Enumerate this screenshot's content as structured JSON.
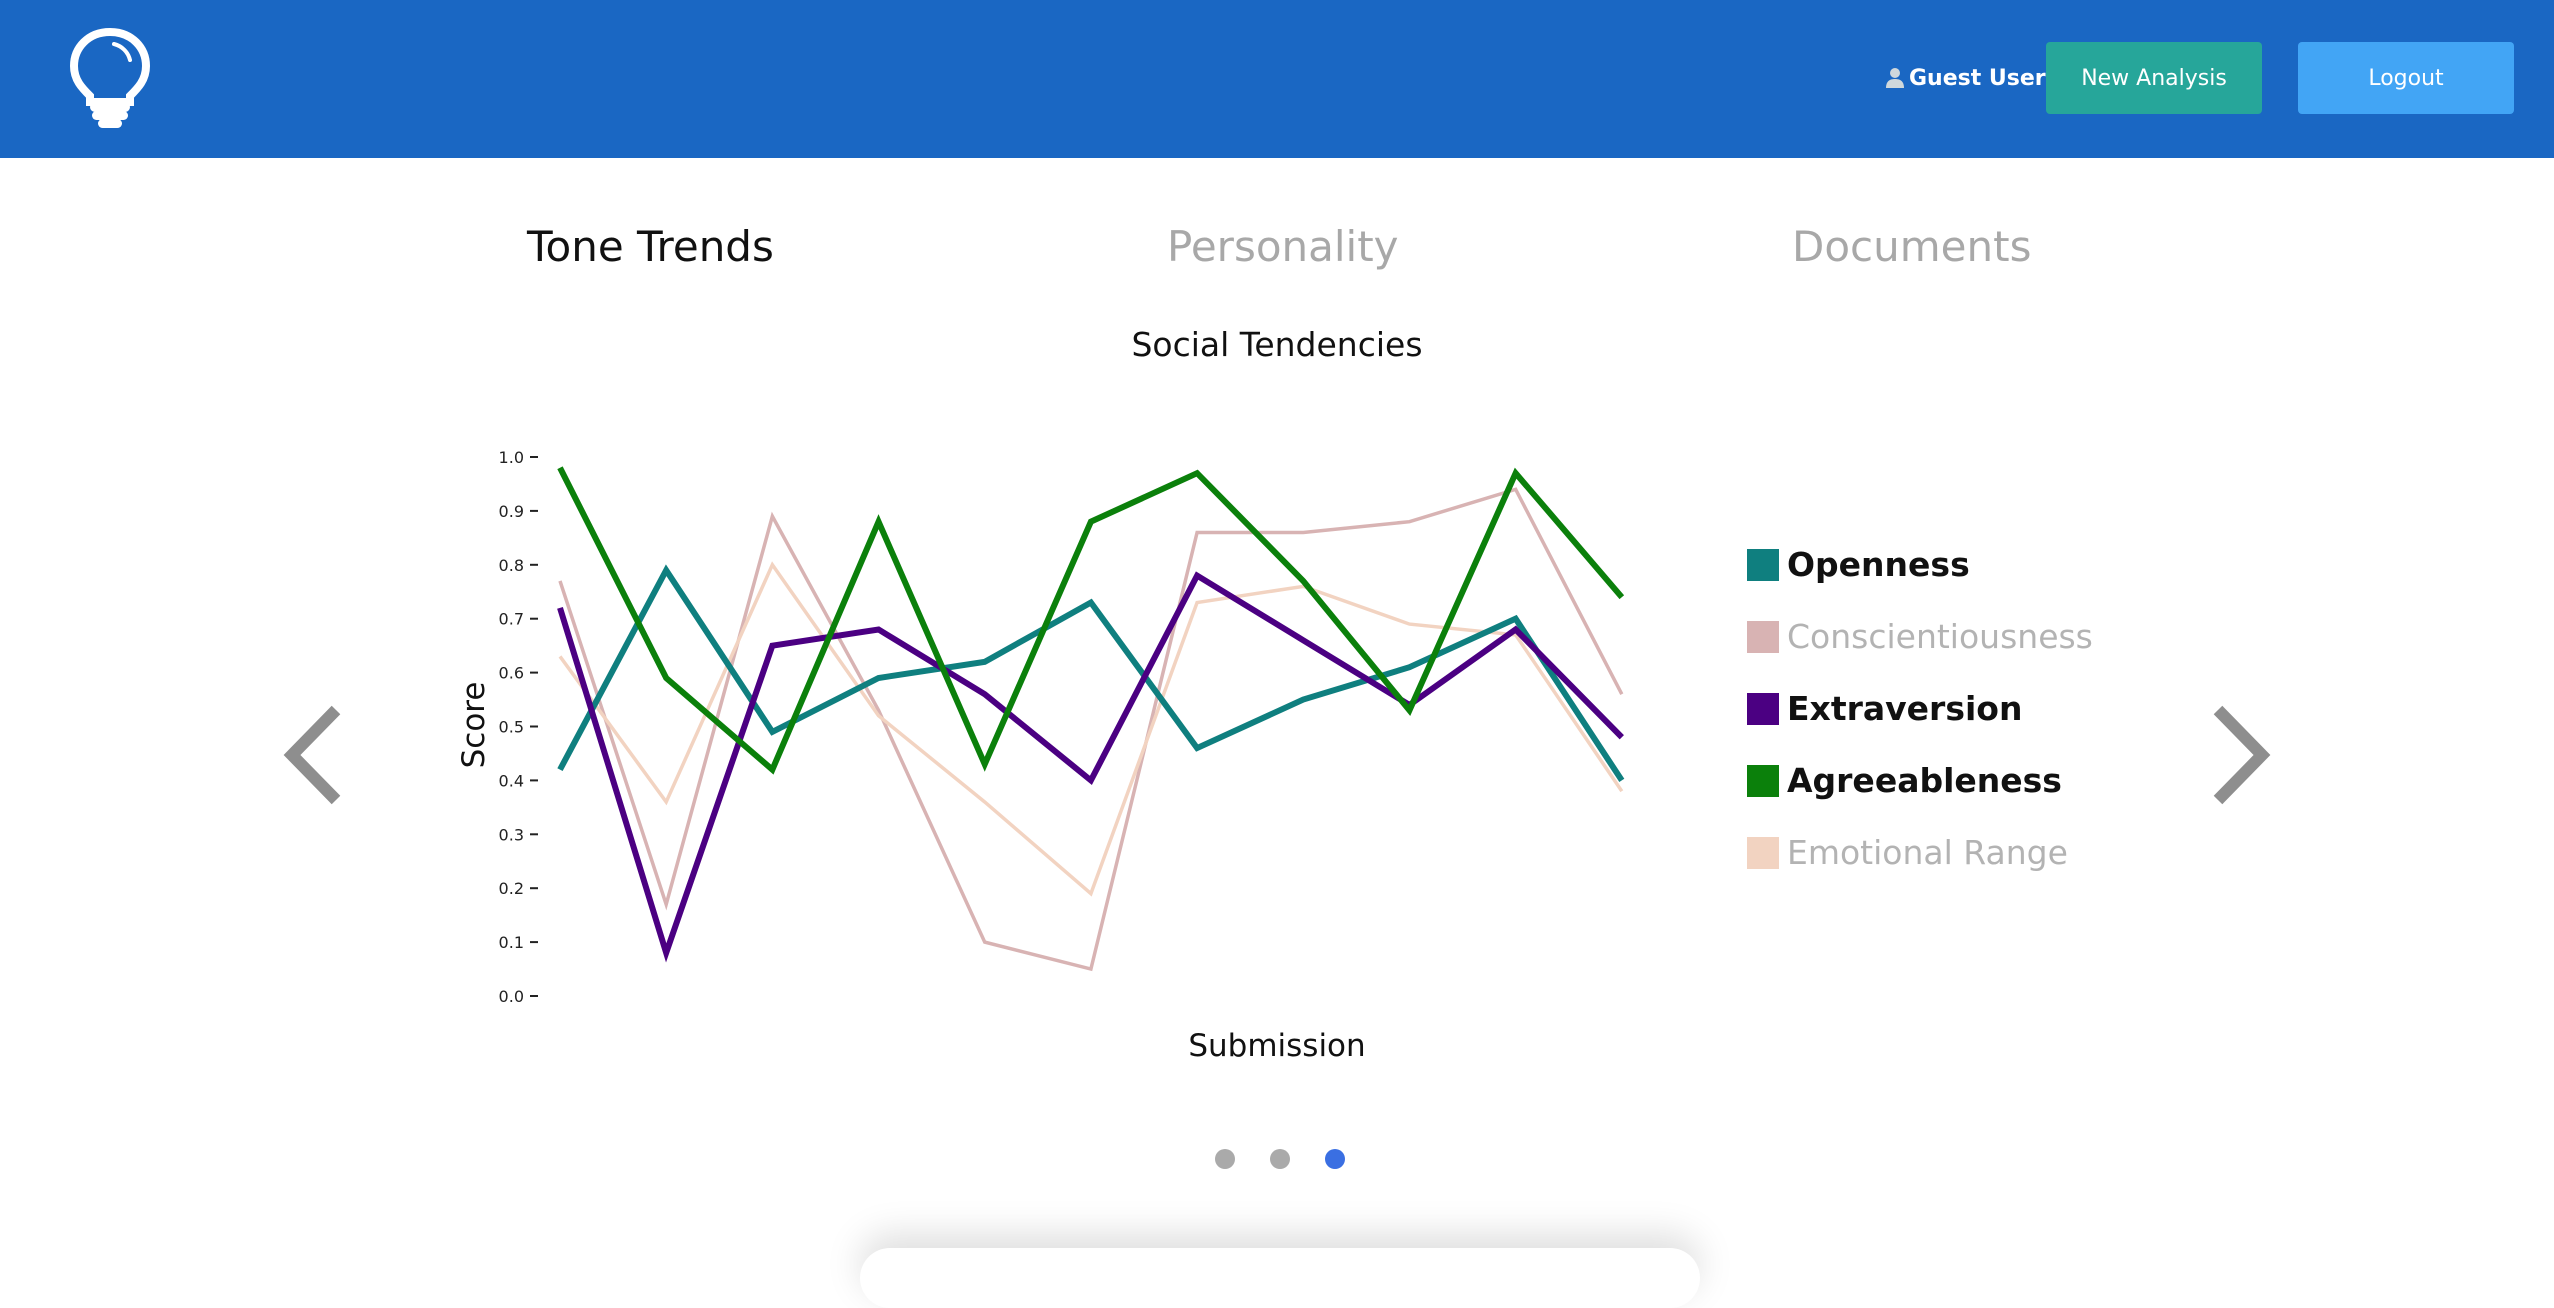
{
  "header": {
    "logo_icon": "lightbulb-icon",
    "user_icon": "user-icon",
    "user_label": "Guest User",
    "new_analysis_label": "New Analysis",
    "logout_label": "Logout",
    "colors": {
      "bar": "#1a67c3",
      "new_analysis": "#26a69a",
      "logout": "#42a5f5"
    }
  },
  "tabs": [
    {
      "label": "Tone Trends",
      "active": true
    },
    {
      "label": "Personality",
      "active": false
    },
    {
      "label": "Documents",
      "active": false
    }
  ],
  "carousel": {
    "prev_icon": "chevron-left-icon",
    "next_icon": "chevron-right-icon",
    "slide_count": 3,
    "active_index": 2
  },
  "chart_data": {
    "type": "line",
    "title": "Social Tendencies",
    "xlabel": "Submission",
    "ylabel": "Score",
    "ylim": [
      0,
      1
    ],
    "yticks": [
      "0.0",
      "0.1",
      "0.2",
      "0.3",
      "0.4",
      "0.5",
      "0.6",
      "0.7",
      "0.8",
      "0.9",
      "1.0"
    ],
    "x": [
      1,
      2,
      3,
      4,
      5,
      6,
      7,
      8,
      9,
      10,
      11,
      12
    ],
    "legend_position": "right",
    "series": [
      {
        "name": "Openness",
        "color": "#0f7f7f",
        "emphasis": true,
        "values": [
          0.42,
          0.79,
          0.49,
          0.59,
          0.62,
          0.73,
          0.46,
          0.55,
          0.61,
          0.7,
          0.4
        ]
      },
      {
        "name": "Conscientiousness",
        "color": "#d8b3b3",
        "emphasis": false,
        "values": [
          0.77,
          0.17,
          0.89,
          0.53,
          0.1,
          0.05,
          0.86,
          0.86,
          0.88,
          0.94,
          0.56
        ]
      },
      {
        "name": "Extraversion",
        "color": "#4b0082",
        "emphasis": true,
        "values": [
          0.72,
          0.08,
          0.65,
          0.68,
          0.56,
          0.4,
          0.78,
          0.66,
          0.54,
          0.68,
          0.48
        ]
      },
      {
        "name": "Agreeableness",
        "color": "#0b800b",
        "emphasis": true,
        "values": [
          0.98,
          0.59,
          0.42,
          0.88,
          0.43,
          0.88,
          0.97,
          0.77,
          0.53,
          0.97,
          0.74
        ]
      },
      {
        "name": "Emotional Range",
        "color": "#f2d3c1",
        "emphasis": false,
        "values": [
          0.63,
          0.36,
          0.8,
          0.52,
          0.36,
          0.19,
          0.73,
          0.76,
          0.69,
          0.67,
          0.38
        ]
      }
    ]
  }
}
